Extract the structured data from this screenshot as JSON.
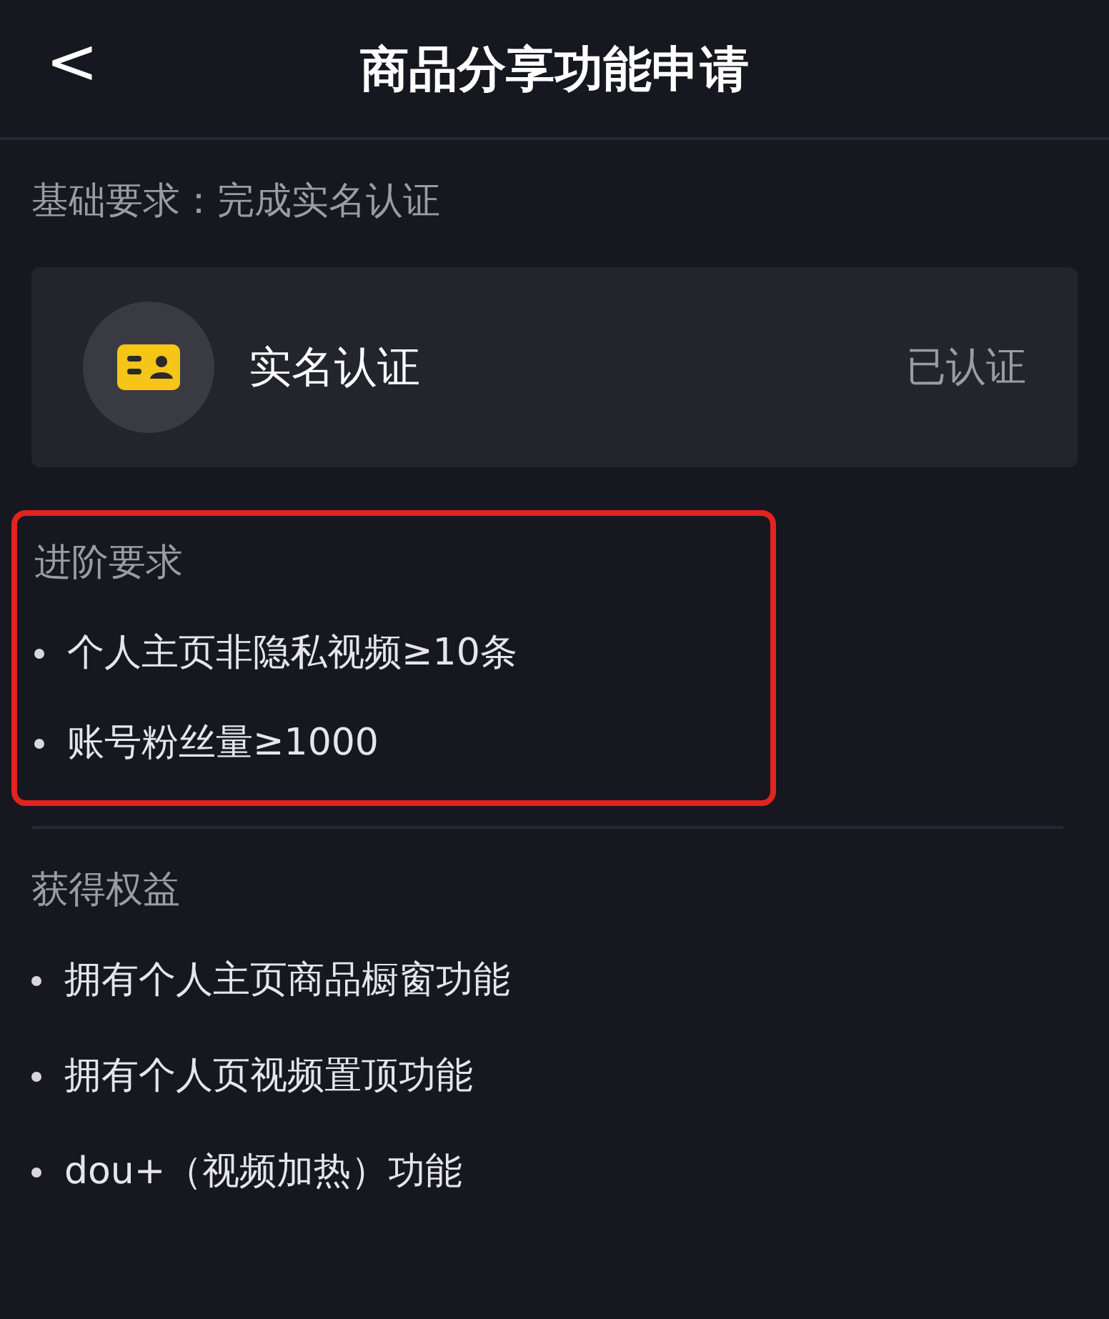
{
  "header": {
    "back": "<",
    "title": "商品分享功能申请"
  },
  "basic": {
    "label": "基础要求：完成实名认证",
    "item": {
      "name": "实名认证",
      "status": "已认证"
    }
  },
  "advanced": {
    "title": "进阶要求",
    "highlighted": true,
    "items": [
      "个人主页非隐私视频≥10条",
      "账号粉丝量≥1000"
    ]
  },
  "benefits": {
    "title": "获得权益",
    "items": [
      "拥有个人主页商品橱窗功能",
      "拥有个人页视频置顶功能",
      "dou+（视频加热）功能"
    ]
  }
}
